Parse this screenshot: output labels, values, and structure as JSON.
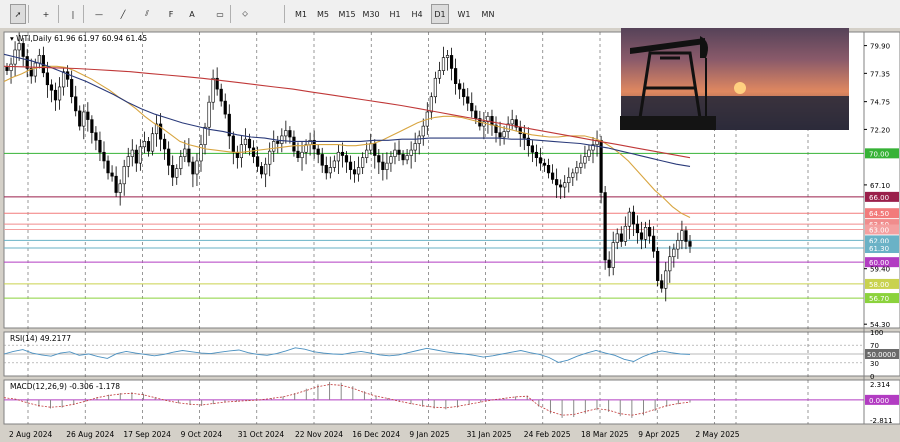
{
  "toolbar": {
    "tools": [
      {
        "name": "cursor-icon",
        "glyph": "➚"
      },
      {
        "name": "crosshair-icon",
        "glyph": "+"
      },
      {
        "name": "vertical-line-icon",
        "glyph": "|"
      },
      {
        "name": "horizontal-line-icon",
        "glyph": "—"
      },
      {
        "name": "trendline-icon",
        "glyph": "╱"
      },
      {
        "name": "channel-icon",
        "glyph": "⫽"
      },
      {
        "name": "fibonacci-icon",
        "glyph": "F"
      },
      {
        "name": "text-icon",
        "glyph": "A"
      },
      {
        "name": "label-icon",
        "glyph": "▭"
      },
      {
        "name": "shapes-icon",
        "glyph": "⬦"
      }
    ],
    "timeframes": [
      "M1",
      "M5",
      "M15",
      "M30",
      "H1",
      "H4",
      "D1",
      "W1",
      "MN"
    ],
    "active_timeframe": "D1"
  },
  "chart_data": [
    {
      "type": "candlestick",
      "title": "WTI,Daily  61.96 61.97 60.94 61.45",
      "ylim": [
        53.95,
        81.15
      ],
      "y_ticks": [
        54.3,
        59.4,
        67.1,
        72.2,
        74.75,
        77.35,
        79.9
      ],
      "x_ticks": [
        "2 Aug 2024",
        "26 Aug 2024",
        "17 Sep 2024",
        "9 Oct 2024",
        "31 Oct 2024",
        "22 Nov 2024",
        "16 Dec 2024",
        "9 Jan 2025",
        "31 Jan 2025",
        "24 Feb 2025",
        "18 Mar 2025",
        "9 Apr 2025",
        "2 May 2025"
      ],
      "horizontal_levels": [
        {
          "value": 70.0,
          "label": "70.00",
          "color": "#4caf50"
        },
        {
          "value": 66.0,
          "label": "66.00",
          "color": "#b03060"
        },
        {
          "value": 64.5,
          "label": "64.50",
          "color": "#e58080"
        },
        {
          "value": 63.5,
          "label": "63.50",
          "color": "#e58080"
        },
        {
          "value": 63.0,
          "label": "63.00",
          "color": "#e58080"
        },
        {
          "value": 62.0,
          "label": "62.00",
          "color": "#78b8c8"
        },
        {
          "value": 61.3,
          "label": "61.30",
          "color": "#78b8c8"
        },
        {
          "value": 60.0,
          "label": "60.00",
          "color": "#b040c0"
        },
        {
          "value": 58.0,
          "label": "58.00",
          "color": "#c8d070"
        },
        {
          "value": 56.7,
          "label": "56.70",
          "color": "#90d060"
        }
      ],
      "level_colors": {
        "70.00": "#36b236",
        "66.00": "#9a1f4a",
        "64.50": "#f27b7b",
        "63.50": "#f08c8c",
        "63.00": "#f4a0a0",
        "62.00": "#6ab2c6",
        "61.30": "#6ab2c6",
        "60.00": "#b23cc2",
        "58.00": "#c9d24e",
        "56.70": "#8bd23c"
      },
      "closes": [
        77.6,
        78.2,
        79.5,
        80.1,
        78.9,
        77.8,
        77.1,
        78.3,
        79.0,
        77.4,
        76.3,
        75.8,
        74.9,
        76.1,
        77.5,
        76.8,
        75.2,
        73.9,
        72.5,
        73.8,
        73.1,
        71.9,
        71.2,
        70.1,
        69.3,
        68.2,
        67.9,
        66.4,
        67.2,
        68.8,
        69.7,
        70.3,
        69.1,
        70.6,
        71.1,
        70.2,
        71.8,
        72.7,
        71.3,
        70.4,
        68.9,
        67.8,
        68.6,
        69.7,
        70.4,
        69.2,
        68.1,
        69.3,
        70.8,
        72.4,
        74.7,
        76.9,
        75.9,
        74.8,
        73.6,
        71.6,
        70.1,
        69.6,
        70.8,
        71.3,
        70.5,
        69.7,
        68.8,
        68.1,
        69.0,
        70.2,
        71.1,
        70.9,
        71.6,
        72.1,
        71.5,
        70.2,
        69.6,
        70.1,
        70.8,
        71.2,
        70.4,
        69.9,
        68.9,
        68.2,
        68.7,
        69.3,
        70.1,
        69.8,
        69.2,
        68.5,
        68.1,
        68.7,
        69.6,
        70.3,
        70.9,
        69.8,
        69.2,
        68.5,
        69.1,
        69.7,
        70.3,
        69.9,
        69.4,
        69.8,
        70.3,
        70.9,
        71.6,
        72.5,
        73.8,
        75.2,
        76.9,
        77.6,
        78.8,
        79.0,
        77.8,
        76.4,
        75.9,
        75.2,
        74.6,
        73.9,
        73.2,
        72.5,
        72.9,
        73.4,
        72.6,
        71.9,
        71.5,
        72.0,
        72.7,
        73.1,
        72.4,
        71.8,
        71.4,
        70.7,
        70.1,
        69.6,
        69.1,
        68.9,
        68.2,
        67.6,
        67.1,
        66.9,
        67.3,
        67.8,
        68.2,
        68.7,
        69.1,
        69.7,
        70.3,
        70.8,
        71.2,
        66.4,
        60.2,
        59.5,
        61.8,
        62.6,
        61.9,
        63.3,
        64.6,
        63.5,
        62.7,
        62.1,
        63.2,
        62.4,
        61.0,
        58.3,
        57.6,
        59.2,
        60.5,
        61.2,
        62.0,
        62.9,
        61.9,
        61.45
      ],
      "ma_fast": [
        76.6,
        77.0,
        77.3,
        77.7,
        77.9,
        78.0,
        78.0,
        77.9,
        77.6,
        77.2,
        76.8,
        76.3,
        75.8,
        75.2,
        74.7,
        74.1,
        73.4,
        72.8,
        72.3,
        71.7,
        71.1,
        70.8,
        70.6,
        70.4,
        70.3,
        70.2,
        70.1,
        70.1,
        70.2,
        70.3,
        70.4,
        70.5,
        70.6,
        70.7,
        70.7,
        70.8,
        70.8,
        70.8,
        70.8,
        70.7,
        70.7,
        70.8,
        70.9,
        71.2,
        71.6,
        72.0,
        72.4,
        72.8,
        73.1,
        73.3,
        73.4,
        73.4,
        73.3,
        73.1,
        72.9,
        72.7,
        72.5,
        72.3,
        72.1,
        71.9,
        71.7,
        71.6,
        71.5,
        71.5,
        71.6,
        71.6,
        71.6,
        71.4,
        71.1,
        70.6,
        70.0,
        69.3,
        68.4,
        67.5,
        66.6,
        65.9,
        65.1,
        64.5,
        64.1
      ],
      "ma_mid": [
        79.1,
        78.8,
        78.5,
        78.1,
        77.6,
        77.1,
        76.6,
        76.0,
        75.4,
        74.7,
        74.1,
        73.6,
        73.2,
        72.8,
        72.5,
        72.2,
        72.0,
        71.7,
        71.5,
        71.4,
        71.2,
        71.1,
        71.1,
        71.1,
        71.1,
        71.1,
        71.1,
        71.2,
        71.2,
        71.3,
        71.3,
        71.4,
        71.4,
        71.4,
        71.4,
        71.4,
        71.4,
        71.3,
        71.3,
        71.2,
        71.1,
        71.0,
        70.9,
        70.7,
        70.5,
        70.2,
        69.9,
        69.6,
        69.3,
        69.0,
        68.8
      ],
      "ma_slow": [
        78.0,
        77.95,
        77.9,
        77.85,
        77.8,
        77.7,
        77.6,
        77.5,
        77.35,
        77.2,
        77.05,
        76.9,
        76.7,
        76.5,
        76.3,
        76.1,
        75.9,
        75.65,
        75.4,
        75.15,
        74.9,
        74.65,
        74.4,
        74.1,
        73.8,
        73.5,
        73.2,
        72.9,
        72.6,
        72.3,
        72.0,
        71.7,
        71.4,
        71.1,
        70.8,
        70.5,
        70.2,
        69.9,
        69.6
      ],
      "ma_colors": {
        "fast": "#d8a540",
        "mid": "#2a3a7a",
        "slow": "#c03838"
      },
      "rsi": {
        "label": "RSI(14) 49.2177",
        "value": 49.2177,
        "levels": [
          30,
          50,
          70,
          100
        ],
        "level_labels": [
          "100",
          "70",
          "50.0000",
          "30",
          "0"
        ],
        "series": [
          50,
          56,
          60,
          52,
          48,
          45,
          52,
          55,
          47,
          50,
          44,
          40,
          51,
          56,
          52,
          49,
          46,
          49,
          54,
          58,
          55,
          52,
          51,
          54,
          57,
          59,
          53,
          49,
          47,
          51,
          57,
          64,
          61,
          55,
          52,
          50,
          49,
          53,
          56,
          52,
          48,
          46,
          48,
          53,
          58,
          63,
          59,
          55,
          52,
          50,
          47,
          43,
          46,
          50,
          54,
          58,
          53,
          49,
          42,
          31,
          36,
          45,
          52,
          58,
          52,
          47,
          38,
          33,
          44,
          52,
          57,
          53,
          50,
          49
        ]
      },
      "macd": {
        "label": "MACD(12,26,9) -0.306 -1.178",
        "ylim": [
          -2.811,
          2.314
        ],
        "tick_labels": [
          "2.314",
          "0.000",
          "-2.811"
        ],
        "series": [
          0.3,
          0.1,
          -0.4,
          -0.8,
          -1.0,
          -0.9,
          -0.6,
          -0.2,
          0.3,
          0.6,
          0.8,
          0.9,
          0.7,
          0.3,
          -0.1,
          -0.4,
          -0.6,
          -0.7,
          -0.5,
          -0.3,
          -0.2,
          -0.1,
          0.0,
          0.2,
          0.4,
          0.8,
          1.3,
          1.8,
          2.1,
          2.0,
          1.6,
          1.0,
          0.5,
          0.2,
          -0.2,
          -0.5,
          -0.8,
          -1.0,
          -1.1,
          -0.9,
          -0.6,
          -0.3,
          0.0,
          0.2,
          0.4,
          0.5,
          -0.8,
          -1.6,
          -2.1,
          -2.0,
          -1.6,
          -1.2,
          -1.4,
          -1.9,
          -2.1,
          -1.8,
          -1.3,
          -0.8,
          -0.5,
          -0.3
        ]
      }
    }
  ]
}
